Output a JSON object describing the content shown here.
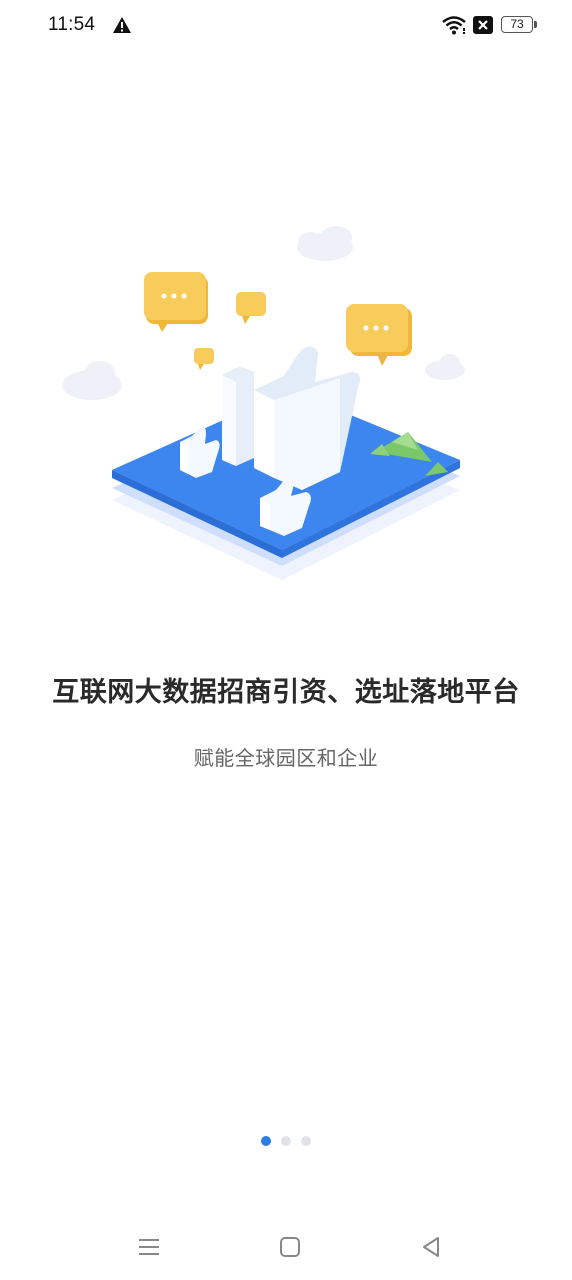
{
  "status_bar": {
    "time": "11:54",
    "battery": "73",
    "icons": [
      "warning-icon",
      "wifi-icon",
      "sim-off-icon",
      "battery-icon"
    ]
  },
  "onboarding": {
    "title": "互联网大数据招商引资、选址落地平台",
    "subtitle": "赋能全球园区和企业",
    "page_index": 1,
    "page_count": 3
  },
  "colors": {
    "accent": "#2d7ce4",
    "dot_inactive": "#e0e3e8",
    "platform_blue": "#3d86ef",
    "bubble_yellow": "#f5c542"
  },
  "nav_bar": {
    "icons": [
      "menu-icon",
      "home-icon",
      "back-icon"
    ]
  }
}
